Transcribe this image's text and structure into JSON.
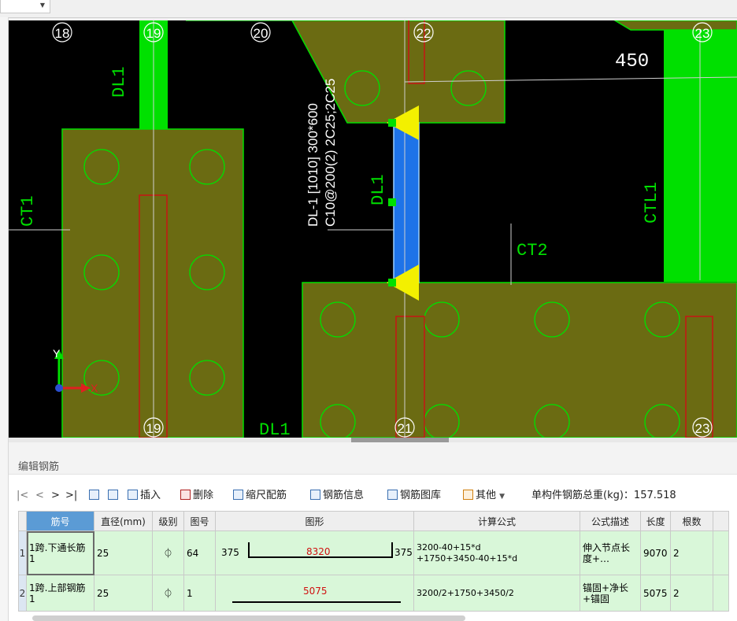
{
  "top_combo": {
    "value": ""
  },
  "cad": {
    "axis_labels": [
      "18",
      "19",
      "20",
      "22",
      "23",
      "19",
      "21",
      "23"
    ],
    "dim_450": "450",
    "beam_text_line1": "DL-1 [1010] 300*600",
    "beam_text_line2": "C10@200(2) 2C25;2C25",
    "labels": {
      "dl1_top": "DL1",
      "dl1_mid": "DL1",
      "dl1_bottom": "DL1",
      "ct1": "CT1",
      "ct2": "CT2",
      "ctl1": "CTL1"
    },
    "axes": {
      "y": "Y",
      "x": "X"
    },
    "colors": {
      "green": "#00e000",
      "olive": "#6b6b12",
      "beam": "#1e73e8",
      "yellow": "#f3f000",
      "red": "#c81414"
    }
  },
  "panel": {
    "title": "编辑钢筋",
    "toolbar": {
      "nav_first": "|<",
      "nav_prev": "<",
      "nav_next": ">",
      "nav_last": ">|",
      "insert": "插入",
      "delete": "删除",
      "scale": "缩尺配筋",
      "info": "钢筋信息",
      "library": "钢筋图库",
      "other": "其他",
      "total_label": "单构件钢筋总重(kg)：157.518"
    },
    "columns": [
      "筋号",
      "直径(mm)",
      "级别",
      "图号",
      "图形",
      "计算公式",
      "公式描述",
      "长度",
      "根数"
    ],
    "rows": [
      {
        "num": "1",
        "name": "1跨.下通长筋1",
        "dia": "25",
        "grade": "⏀",
        "fig": "64",
        "left": "375",
        "mid": "8320",
        "right": "375",
        "formula_1": "3200-40+15*d",
        "formula_2": "+1750+3450-40+15*d",
        "desc": "伸入节点长度+…",
        "len": "9070",
        "count": "2"
      },
      {
        "num": "2",
        "name": "1跨.上部钢筋1",
        "dia": "25",
        "grade": "⏀",
        "fig": "1",
        "mid": "5075",
        "formula_1": "3200/2+1750+3450/2",
        "desc": "锚固+净长+锚固",
        "len": "5075",
        "count": "2"
      }
    ]
  }
}
